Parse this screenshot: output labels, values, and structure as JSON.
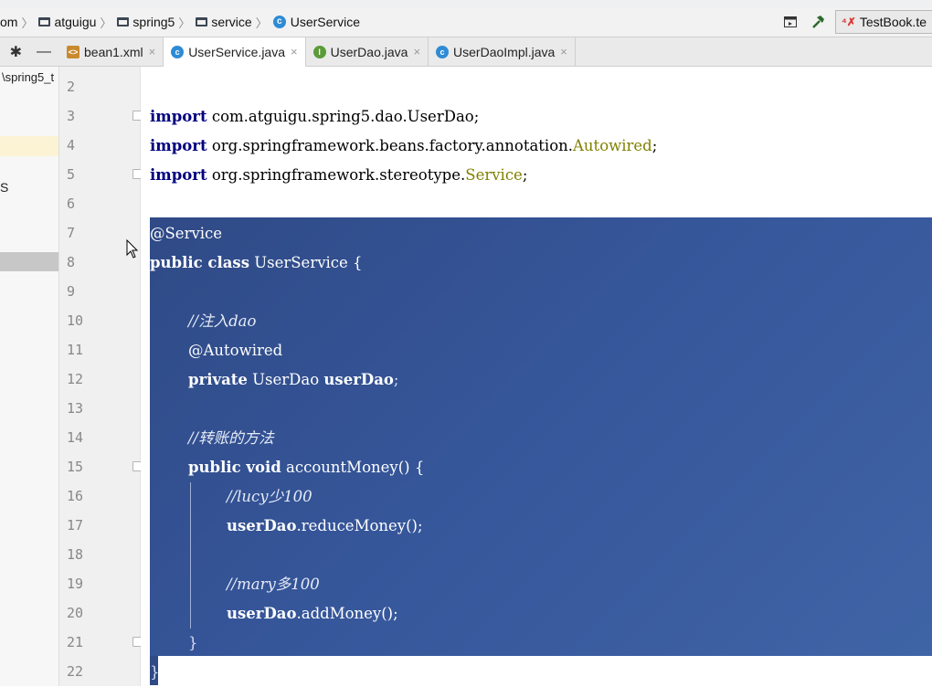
{
  "breadcrumb": {
    "items": [
      {
        "label": "om",
        "icon": "none"
      },
      {
        "label": "atguigu",
        "icon": "folder-icon"
      },
      {
        "label": "spring5",
        "icon": "folder-icon"
      },
      {
        "label": "service",
        "icon": "folder-icon"
      },
      {
        "label": "UserService",
        "icon": "class-icon"
      }
    ]
  },
  "toolbar": {
    "run_config_label": "TestBook.te",
    "build_icon": "hammer-icon",
    "window_icon": "window-icon"
  },
  "project_panel": {
    "path_fragment": "spring5_t",
    "row_mark": "S"
  },
  "tabs": [
    {
      "label": "bean1.xml",
      "icon": "xml-icon",
      "active": false
    },
    {
      "label": "UserService.java",
      "icon": "class-icon",
      "active": true
    },
    {
      "label": "UserDao.java",
      "icon": "interface-icon",
      "active": false
    },
    {
      "label": "UserDaoImpl.java",
      "icon": "class-icon",
      "active": false
    }
  ],
  "editor": {
    "line_numbers": [
      "2",
      "3",
      "4",
      "5",
      "6",
      "7",
      "8",
      "9",
      "10",
      "11",
      "12",
      "13",
      "14",
      "15",
      "16",
      "17",
      "18",
      "19",
      "20",
      "21",
      "22"
    ],
    "code": {
      "l3_kw": "import",
      "l3_rest": " com.atguigu.spring5.dao.UserDao;",
      "l4_kw": "import",
      "l4_rest": " org.springframework.beans.factory.annotation.",
      "l4_ann": "Autowired",
      "l4_end": ";",
      "l5_kw": "import",
      "l5_rest": " org.springframework.stereotype.",
      "l5_ann": "Service",
      "l5_end": ";",
      "l7": "@Service",
      "l8_kw": "public class",
      "l8_rest": " UserService {",
      "l10": "//注入dao",
      "l11": "@Autowired",
      "l12_kw": "private",
      "l12_rest": " UserDao ",
      "l12_field": "userDao",
      "l12_end": ";",
      "l14": "//转账的方法",
      "l15_kw": "public void",
      "l15_rest": " accountMoney() {",
      "l16": "//lucy少100",
      "l17_field": "userDao",
      "l17_rest": ".reduceMoney();",
      "l19": "//mary多100",
      "l20_field": "userDao",
      "l20_rest": ".addMoney();",
      "l21": "}",
      "l22": "}"
    }
  },
  "colors": {
    "selection": "#36569a",
    "keyword": "#000080",
    "annotation": "#808000"
  }
}
